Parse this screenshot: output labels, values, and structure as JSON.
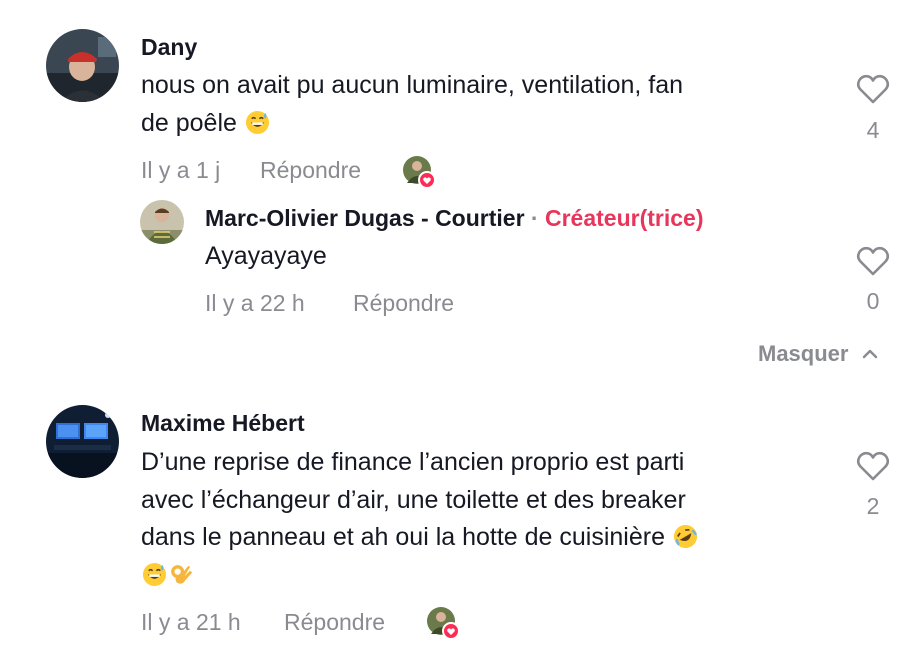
{
  "comments": [
    {
      "author": "Dany",
      "text_line1": "nous on avait pu aucun luminaire, ventilation, fan",
      "text_line2": "de poêle",
      "emojis": [
        "grinning-sweat"
      ],
      "time": "Il y a 1 j",
      "reply_label": "Répondre",
      "like_count": "4",
      "liked_by_creator": true
    },
    {
      "author": "Maxime Hébert",
      "text_line1": "D’une reprise de finance l’ancien proprio est parti",
      "text_line2": "avec l’échangeur d’air, une toilette et des breaker",
      "text_line3": "dans le panneau et ah oui la hotte de cuisinière",
      "emojis": [
        "rolling-on-floor-laughing",
        "grinning-sweat",
        "ok-hand"
      ],
      "time": "Il y a 21 h",
      "reply_label": "Répondre",
      "like_count": "2",
      "liked_by_creator": true
    }
  ],
  "reply": {
    "author": "Marc-Olivier Dugas - Courtier",
    "separator": "·",
    "badge": "Créateur(trice)",
    "text": "Ayayayaye",
    "time": "Il y a 22 h",
    "reply_label": "Répondre",
    "like_count": "0"
  },
  "collapse_label": "Masquer",
  "colors": {
    "creator_badge": "#e8355b",
    "meta_text": "#8a8b91",
    "heart_outline": "#8a8b91",
    "like_badge": "#fe2c55"
  }
}
